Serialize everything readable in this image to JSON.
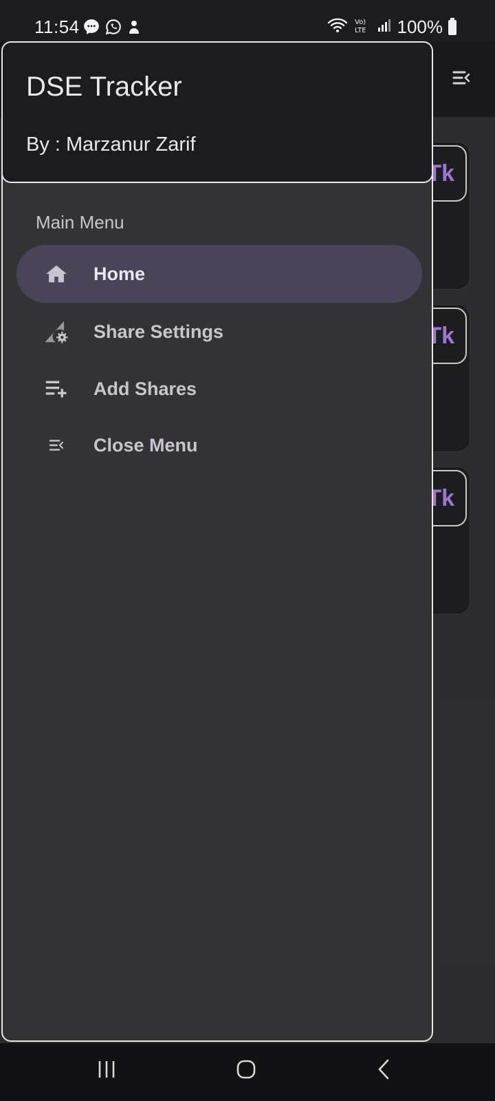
{
  "status_bar": {
    "time": "11:54",
    "battery": "100%",
    "left_icons": [
      "messenger-icon",
      "whatsapp-icon",
      "app-notification-icon"
    ],
    "right_icons": [
      "wifi-icon",
      "volte-icon",
      "signal-icon",
      "battery-icon"
    ]
  },
  "app": {
    "menu_icon": "menu-open-icon",
    "cards": [
      {
        "badge": "Tk"
      },
      {
        "badge": "Tk"
      },
      {
        "badge": "Tk"
      }
    ]
  },
  "drawer": {
    "title": "DSE Tracker",
    "subtitle": "By : Marzanur Zarif",
    "section_label": "Main Menu",
    "items": [
      {
        "label": "Home",
        "icon": "home-icon",
        "active": true
      },
      {
        "label": "Share Settings",
        "icon": "signal-settings-icon",
        "active": false
      },
      {
        "label": "Add Shares",
        "icon": "playlist-add-icon",
        "active": false
      },
      {
        "label": "Close Menu",
        "icon": "menu-open-icon",
        "active": false
      }
    ]
  },
  "navigation_bar": {
    "buttons": [
      "recents-button",
      "home-button",
      "back-button"
    ]
  },
  "colors": {
    "accent_text": "#b487f0",
    "active_item_bg": "#4a4458",
    "drawer_bg": "#333335",
    "header_bg": "#1c1b1f"
  }
}
